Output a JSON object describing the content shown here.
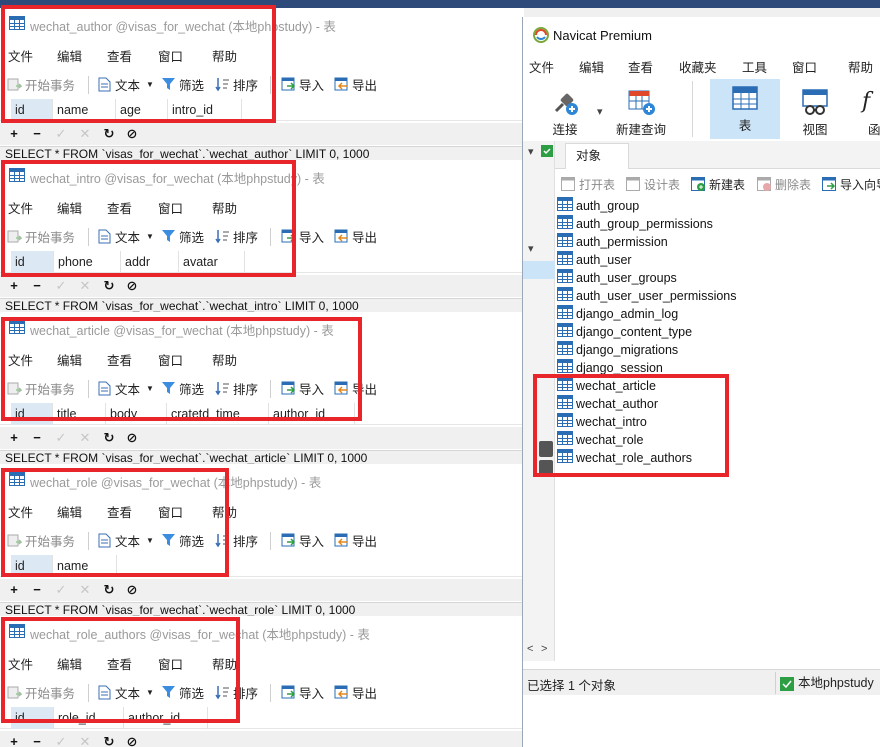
{
  "menu": [
    "文件",
    "编辑",
    "查看",
    "窗口",
    "帮助"
  ],
  "toolbar": {
    "begin_tx": "开始事务",
    "text": "文本",
    "filter": "筛选",
    "sort": "排序",
    "import": "导入",
    "export": "导出"
  },
  "tables": [
    {
      "title": "wechat_author @visas_for_wechat (本地phpstudy) - 表",
      "columns": [
        "id",
        "name",
        "age",
        "intro_id"
      ],
      "sql": "SELECT * FROM `visas_for_wechat`.`wechat_author` LIMIT 0, 1000"
    },
    {
      "title": "wechat_intro @visas_for_wechat (本地phpstudy) - 表",
      "columns": [
        "id",
        "phone",
        "addr",
        "avatar"
      ],
      "sql": "SELECT * FROM `visas_for_wechat`.`wechat_intro` LIMIT 0, 1000"
    },
    {
      "title": "wechat_article @visas_for_wechat (本地phpstudy) - 表",
      "columns": [
        "id",
        "title",
        "body",
        "cratetd_time",
        "author_id"
      ],
      "sql": "SELECT * FROM `visas_for_wechat`.`wechat_article` LIMIT 0, 1000"
    },
    {
      "title": "wechat_role @visas_for_wechat (本地phpstudy) - 表",
      "columns": [
        "id",
        "name"
      ],
      "sql": "SELECT * FROM `visas_for_wechat`.`wechat_role` LIMIT 0, 1000"
    },
    {
      "title": "wechat_role_authors @visas_for_wechat (本地phpstudy) - 表",
      "columns": [
        "id",
        "role_id",
        "author_id"
      ],
      "sql": ""
    }
  ],
  "navicat": {
    "title": "Navicat Premium",
    "menu": [
      "文件",
      "编辑",
      "查看",
      "收藏夹",
      "工具",
      "窗口",
      "帮助"
    ],
    "ribbon": [
      "连接",
      "新建查询",
      "表",
      "视图",
      "函"
    ],
    "objects_tab": "对象",
    "obj_toolbar": [
      "打开表",
      "设计表",
      "新建表",
      "删除表",
      "导入向导"
    ],
    "objects": [
      "auth_group",
      "auth_group_permissions",
      "auth_permission",
      "auth_user",
      "auth_user_groups",
      "auth_user_user_permissions",
      "django_admin_log",
      "django_content_type",
      "django_migrations",
      "django_session",
      "wechat_article",
      "wechat_author",
      "wechat_intro",
      "wechat_role",
      "wechat_role_authors"
    ],
    "status_left": "已选择 1 个对象",
    "status_right": "本地phpstudy"
  },
  "colors": {
    "highlight": "#e8252b",
    "selected_tab": "#cce4f7",
    "table_icon": "#2a6db5"
  }
}
